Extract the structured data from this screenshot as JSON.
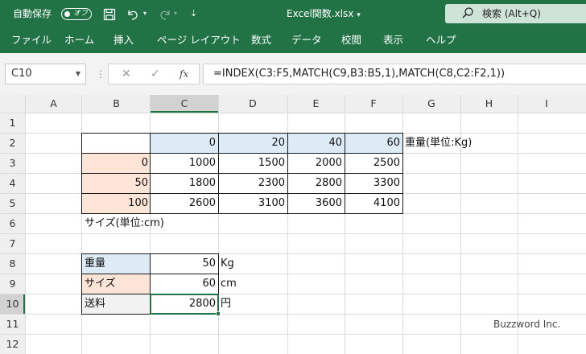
{
  "titlebar": {
    "autosave_label": "自動保存",
    "autosave_state": "オフ",
    "filename": "Excel関数.xlsx",
    "search_placeholder": "検索 (Alt+Q)"
  },
  "ribbon": {
    "tabs": [
      "ファイル",
      "ホーム",
      "挿入",
      "ページ レイアウト",
      "数式",
      "データ",
      "校閲",
      "表示",
      "ヘルプ"
    ]
  },
  "formula_bar": {
    "name_box": "C10",
    "fx": "fx",
    "formula": "=INDEX(C3:F5,MATCH(C9,B3:B5,1),MATCH(C8,C2:F2,1))"
  },
  "sheet": {
    "columns": [
      "A",
      "B",
      "C",
      "D",
      "E",
      "F",
      "G",
      "H",
      "I"
    ],
    "rows": [
      "1",
      "2",
      "3",
      "4",
      "5",
      "6",
      "7",
      "8",
      "9",
      "10",
      "11",
      "12"
    ],
    "selected_cell": "C10",
    "cells": {
      "C2": "0",
      "D2": "20",
      "E2": "40",
      "F2": "60",
      "G2": "重量(単位:Kg)",
      "B3": "0",
      "C3": "1000",
      "D3": "1500",
      "E3": "2000",
      "F3": "2500",
      "B4": "50",
      "C4": "1800",
      "D4": "2300",
      "E4": "2800",
      "F4": "3300",
      "B5": "100",
      "C5": "2600",
      "D5": "3100",
      "E5": "3600",
      "F5": "4100",
      "B6": "サイズ(単位:cm)",
      "B8": "重量",
      "C8": "50",
      "D8": "Kg",
      "B9": "サイズ",
      "C9": "60",
      "D9": "cm",
      "B10": "送料",
      "C10": "2800",
      "D10": "円"
    },
    "colors": {
      "header_blue": "#ddebf7",
      "header_peach": "#fce4d6",
      "label_gray": "#f2f2f2",
      "selection_green": "#217346"
    }
  },
  "watermark": "Buzzword Inc."
}
